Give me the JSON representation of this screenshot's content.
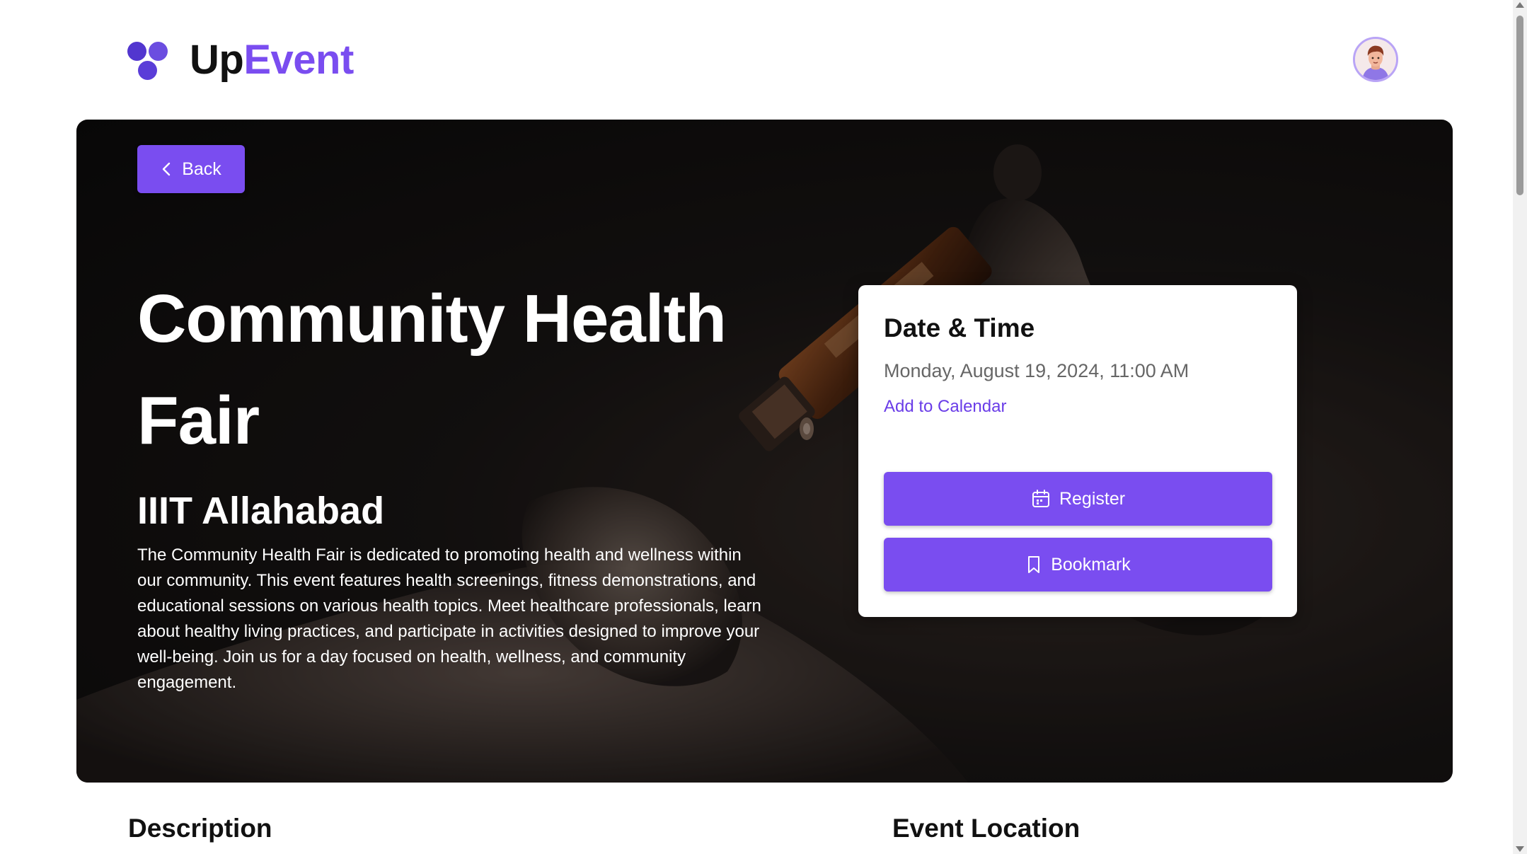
{
  "header": {
    "brand_primary": "Up",
    "brand_accent": "Event",
    "brand_color": "#7a4df0",
    "logo_icon": "three-dots-logo-icon",
    "avatar_icon": "user-avatar-icon"
  },
  "hero": {
    "back_label": "Back",
    "title": "Community Health Fair",
    "venue": "IIIT Allahabad",
    "description": "The Community Health Fair is dedicated to promoting health and wellness within our community. This event features health screenings, fitness demonstrations, and educational sessions on various health topics. Meet healthcare professionals, learn about healthy living practices, and participate in activities designed to improve your well-being. Join us for a day focused on health, wellness, and community engagement."
  },
  "date_time_card": {
    "title": "Date & Time",
    "value": "Monday, August 19, 2024, 11:00 AM",
    "add_to_calendar": "Add to Calendar",
    "register_label": "Register",
    "register_icon": "calendar-icon",
    "bookmark_label": "Bookmark",
    "bookmark_icon": "bookmark-icon"
  },
  "sections": {
    "description_title": "Description",
    "location_title": "Event Location"
  }
}
